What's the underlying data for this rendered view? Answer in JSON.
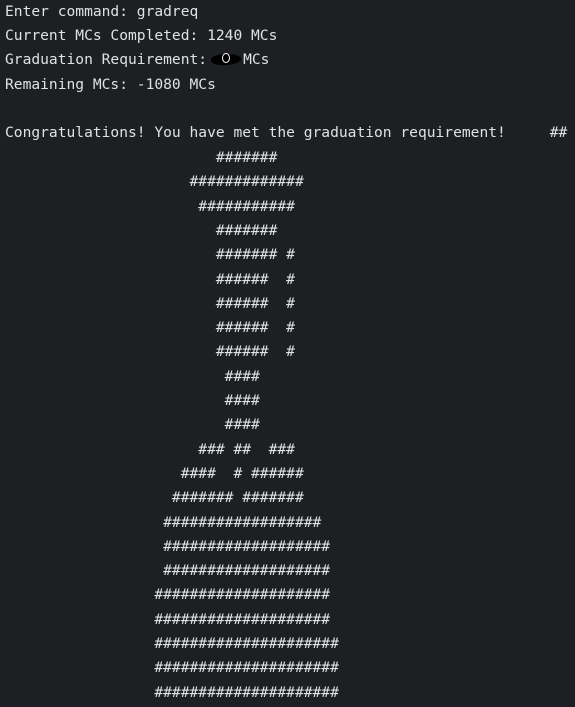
{
  "terminal": {
    "command_prompt": "Enter command: gradreq",
    "mcs_completed": "Current MCs Completed: 1240 MCs",
    "grad_requirement_prefix": "Graduation Requirement:",
    "grad_requirement_suffix": "MCs",
    "remaining_mcs": "Remaining MCs: -1080 MCs",
    "congrats_message": "Congratulations! You have met the graduation requirement!     ##",
    "ascii_art": [
      "                        #######",
      "                     #############",
      "                      ###########",
      "                        #######",
      "                        ####### #",
      "                        ######  #",
      "                        ######  #",
      "                        ######  #",
      "                        ######  #",
      "                         ####",
      "                         ####",
      "                         ####",
      "                      ### ##  ###",
      "                    ####  # ######",
      "                   ####### #######",
      "                  ##################",
      "                  ###################",
      "                  ###################",
      "                 ####################",
      "                 ####################",
      "                 #####################",
      "                 #####################",
      "                 #####################"
    ]
  },
  "colors": {
    "background": "#1e1f22",
    "text": "#dfe1e5"
  }
}
